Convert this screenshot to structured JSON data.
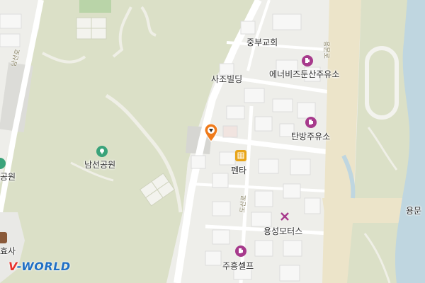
{
  "map": {
    "labels": {
      "jungbu_church": "중부교회",
      "sajo_building": "사조빌딩",
      "energy_gas": "에너비즈둔산주유소",
      "tanbang_gas": "탄방주유소",
      "penta": "펜타",
      "namseon_park": "남선공원",
      "yongseong_motors": "용성모터스",
      "juheung_self": "주흥셀프",
      "left_park_partial": "공원",
      "left_temple_partial": "효사",
      "right_road_partial": "용문",
      "road_namseon": "남선로",
      "road_doan": "도산로",
      "road_yongmun": "용문로"
    },
    "icons": {
      "gas_station": "gas-station-icon",
      "restaurant": "restaurant-icon",
      "repair": "wrench-icon",
      "park": "park-icon",
      "marker": "location-pin-icon"
    },
    "colors": {
      "park_green": "#dbe0c7",
      "water": "#bfd6e0",
      "road_major": "#ece4c9",
      "building": "#f7f7f6",
      "poi_magenta": "#a73a8c",
      "poi_yellow": "#e8a51a",
      "marker_orange": "#ef7a1a"
    },
    "logo": {
      "v": "V",
      "rest": "-WORLD"
    }
  }
}
